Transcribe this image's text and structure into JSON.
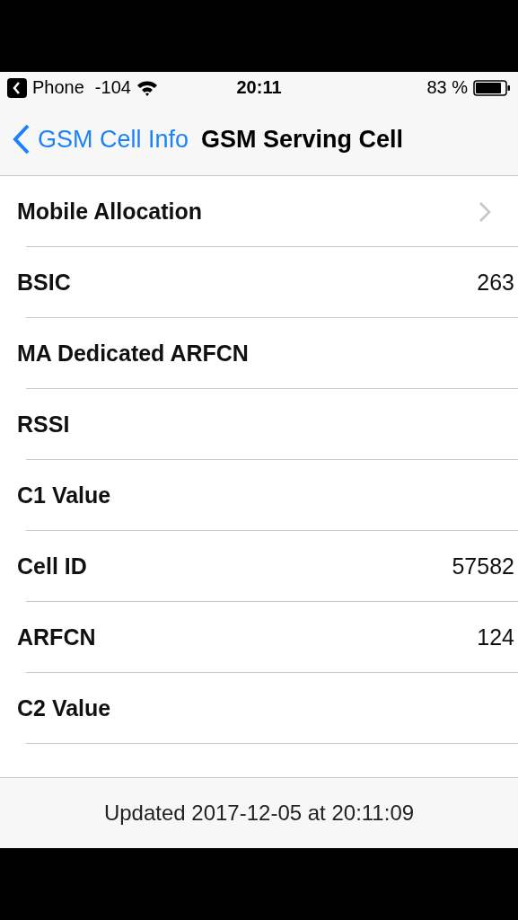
{
  "status_bar": {
    "back_app": "Phone",
    "signal": "-104",
    "time": "20:11",
    "battery": "83 %"
  },
  "nav": {
    "back": "GSM Cell Info",
    "title": "GSM Serving Cell"
  },
  "rows": [
    {
      "kind": "link",
      "label": "Mobile Allocation"
    },
    {
      "kind": "value",
      "label": "BSIC",
      "value": "263"
    },
    {
      "kind": "value",
      "label": "MA Dedicated ARFCN"
    },
    {
      "kind": "value",
      "label": "RSSI"
    },
    {
      "kind": "value",
      "label": "C1 Value"
    },
    {
      "kind": "value",
      "label": "Cell ID",
      "value": "57582"
    },
    {
      "kind": "value",
      "label": "ARFCN",
      "value": "124"
    },
    {
      "kind": "value",
      "label": "C2 Value"
    }
  ],
  "footer": "Updated 2017-12-05 at 20:11:09"
}
